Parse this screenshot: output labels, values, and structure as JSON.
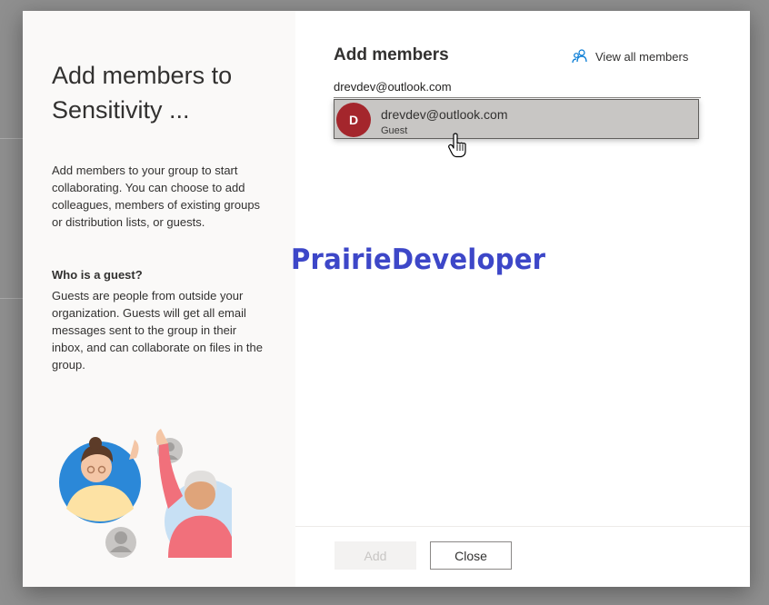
{
  "panel": {
    "title": "Add members to Sensitivity ...",
    "description": "Add members to your group to start collaborating. You can choose to add colleagues, members of existing groups or distribution lists, or guests.",
    "guest_heading": "Who is a guest?",
    "guest_description": "Guests are people from outside your organization. Guests will get all email messages sent to the group in their inbox, and can collaborate on files in the group."
  },
  "main": {
    "title": "Add members",
    "view_all_label": "View all members",
    "view_all_icon": "people-icon",
    "search_value": "drevdev@outlook.com",
    "suggestion": {
      "initial": "D",
      "email": "drevdev@outlook.com",
      "type": "Guest",
      "avatar_color": "#a4262c"
    }
  },
  "watermark": "PrairieDeveloper",
  "footer": {
    "add_label": "Add",
    "close_label": "Close"
  },
  "colors": {
    "accent": "#0078d4",
    "watermark": "#3d47c8"
  }
}
